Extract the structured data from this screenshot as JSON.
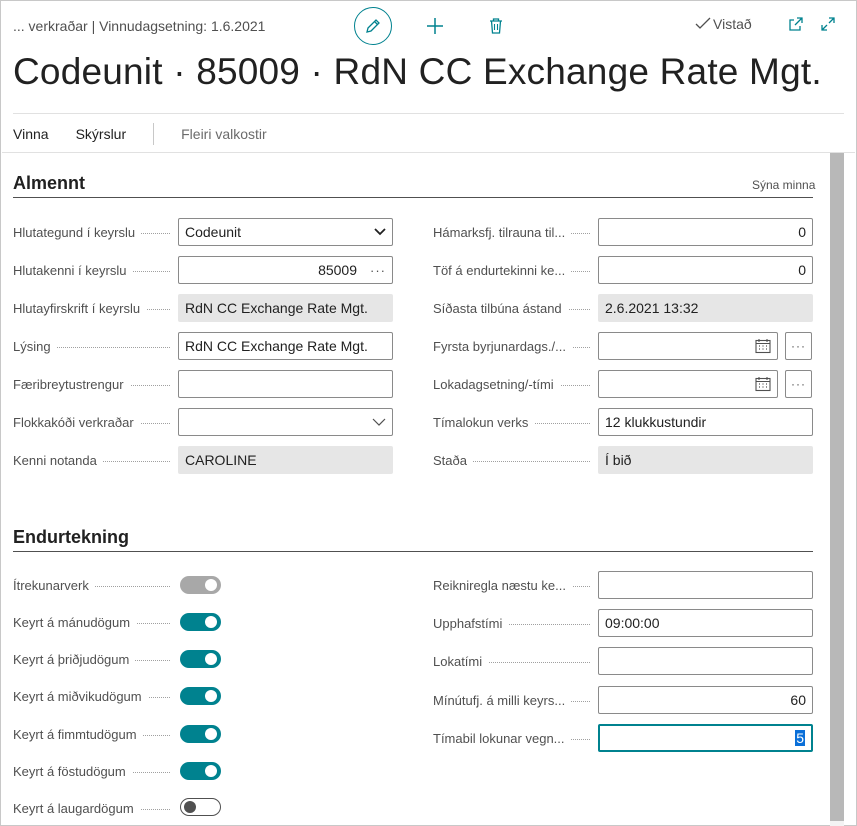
{
  "header": {
    "breadcrumb": "... verkraðar | Vinnudagsetning: 1.6.2021",
    "view_label": "Vistað",
    "title": "Codeunit · 85009 · RdN CC Exchange Rate Mgt."
  },
  "menu": {
    "items": [
      "Vinna",
      "Skýrslur"
    ],
    "more": "Fleiri valkostir"
  },
  "general": {
    "title": "Almennt",
    "show_less": "Sýna minna",
    "left": [
      {
        "label": "Hlutategund í keyrslu",
        "value": "Codeunit"
      },
      {
        "label": "Hlutakenni í keyrslu",
        "value": "85009"
      },
      {
        "label": "Hlutayfirskrift í keyrslu",
        "value": "RdN CC Exchange Rate Mgt."
      },
      {
        "label": "Lýsing",
        "value": "RdN CC Exchange Rate Mgt."
      },
      {
        "label": "Færibreytustrengur",
        "value": ""
      },
      {
        "label": "Flokkakóði verkraðar",
        "value": ""
      },
      {
        "label": "Kenni notanda",
        "value": "CAROLINE"
      }
    ],
    "right": [
      {
        "label": "Hámarksfj. tilrauna til...",
        "value": "0"
      },
      {
        "label": "Töf á endurtekinni ke...",
        "value": "0"
      },
      {
        "label": "Síðasta tilbúna ástand",
        "value": "2.6.2021 13:32"
      },
      {
        "label": "Fyrsta byrjunardags./...",
        "value": ""
      },
      {
        "label": "Lokadagsetning/-tími",
        "value": ""
      },
      {
        "label": "Tímalokun verks",
        "value": "12 klukkustundir"
      },
      {
        "label": "Staða",
        "value": "Í bið"
      }
    ]
  },
  "recurrence": {
    "title": "Endurtekning",
    "left": [
      {
        "label": "Ítrekunarverk",
        "state": "on-disabled"
      },
      {
        "label": "Keyrt á mánudögum",
        "state": "on"
      },
      {
        "label": "Keyrt á þriðjudögum",
        "state": "on"
      },
      {
        "label": "Keyrt á miðvikudögum",
        "state": "on"
      },
      {
        "label": "Keyrt á fimmtudögum",
        "state": "on"
      },
      {
        "label": "Keyrt á föstudögum",
        "state": "on"
      },
      {
        "label": "Keyrt á laugardögum",
        "state": "off"
      }
    ],
    "right": [
      {
        "label": "Reikniregla næstu ke...",
        "value": ""
      },
      {
        "label": "Upphafstími",
        "value": "09:00:00"
      },
      {
        "label": "Lokatími",
        "value": ""
      },
      {
        "label": "Mínútufj. á milli keyrs...",
        "value": "60"
      },
      {
        "label": "Tímabil lokunar vegn...",
        "value": "5"
      }
    ]
  },
  "colors": {
    "accent": "#00828f",
    "toggle_disabled": "#a8a8a8",
    "readonly_bg": "#e6e6e6",
    "selection": "#0a6fd8"
  }
}
